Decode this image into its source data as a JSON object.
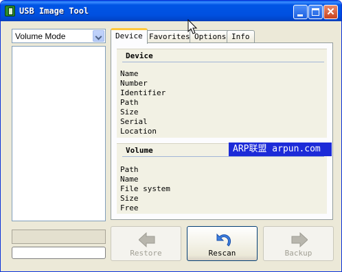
{
  "window": {
    "title": "USB Image Tool"
  },
  "sidebar": {
    "mode_value": "Volume Mode"
  },
  "tabs": [
    {
      "label": "Device",
      "active": true
    },
    {
      "label": "Favorites"
    },
    {
      "label": "Options"
    },
    {
      "label": "Info"
    }
  ],
  "device_group": {
    "title": "Device",
    "fields": [
      "Name",
      "Number",
      "Identifier",
      "Path",
      "Size",
      "Serial",
      "Location"
    ]
  },
  "volume_group": {
    "title": "Volume",
    "fields": [
      "Path",
      "Name",
      "File system",
      "Size",
      "Free"
    ]
  },
  "watermark": "ARP联盟 arpun.com",
  "buttons": {
    "restore": {
      "label": "Restore",
      "enabled": false
    },
    "rescan": {
      "label": "Rescan",
      "enabled": true
    },
    "backup": {
      "label": "Backup",
      "enabled": false
    }
  },
  "colors": {
    "title_bar": "#0055e5",
    "accent_tab": "#ffc83c",
    "watermark_bg": "#1c2bd8"
  }
}
